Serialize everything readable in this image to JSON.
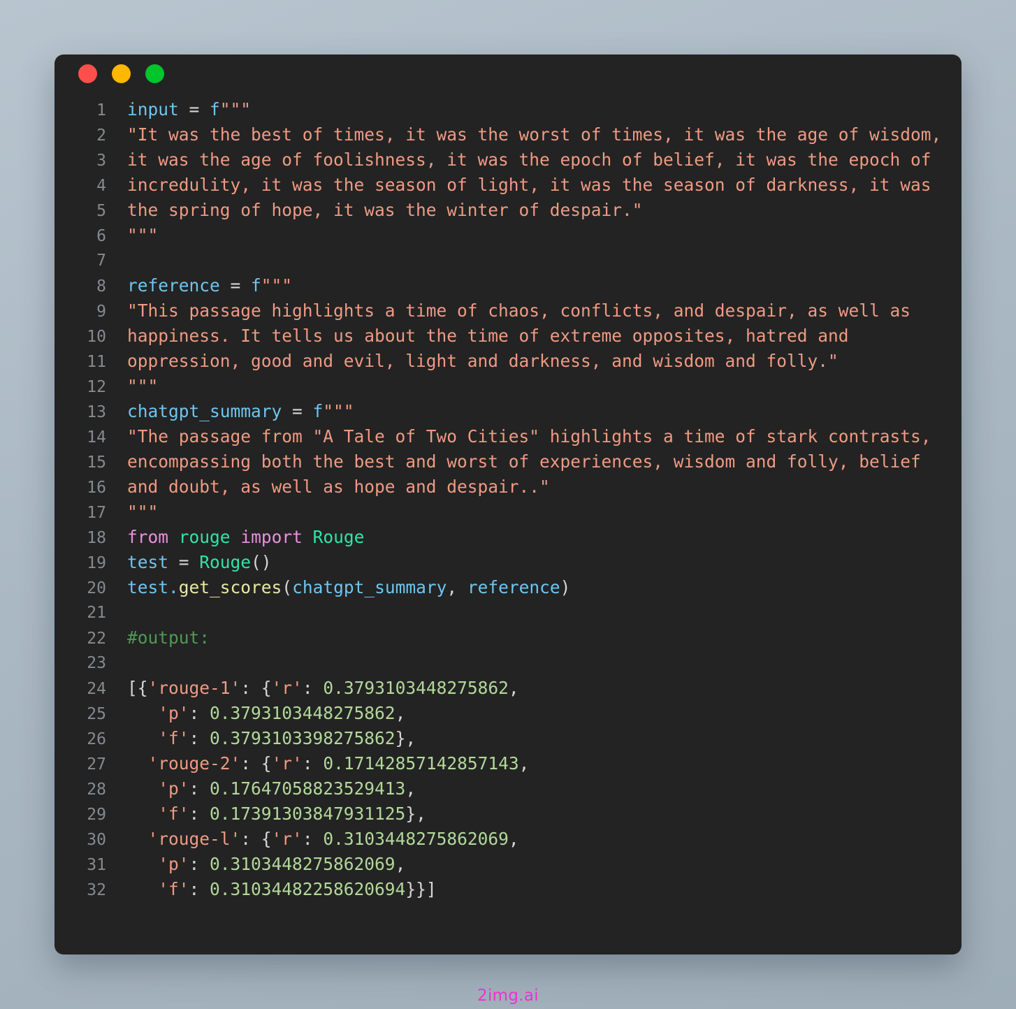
{
  "window": {
    "title_bar": {
      "close_label": "close",
      "minimize_label": "minimize",
      "maximize_label": "maximize"
    },
    "colors": {
      "background_panel": "#232323",
      "close_dot": "#ff4f4b",
      "minimize_dot": "#ffb700",
      "maximize_dot": "#00c62b",
      "line_number": "#848b90",
      "variable": "#6ec5ef",
      "string": "#ef9a83",
      "keyword": "#e98fe0",
      "class": "#2de6a8",
      "function": "#e8e8a3",
      "number": "#b2d89a",
      "comment": "#4e9a53",
      "watermark": "#f42ad3"
    }
  },
  "watermark": "2img.ai",
  "code": {
    "language": "python",
    "line_numbers": [
      1,
      2,
      3,
      4,
      5,
      6,
      7,
      8,
      9,
      10,
      11,
      12,
      13,
      14,
      15,
      16,
      17,
      18,
      19,
      20,
      21,
      22,
      23,
      24,
      25,
      26,
      27,
      28,
      29,
      30,
      31,
      32
    ],
    "lines": [
      {
        "n": "1",
        "text": "input = f\"\"\""
      },
      {
        "n": "2",
        "text": "\"It was the best of times, it was the worst of times, it was the age of wisdom,"
      },
      {
        "n": "3",
        "text": "it was the age of foolishness, it was the epoch of belief, it was the epoch of"
      },
      {
        "n": "4",
        "text": "incredulity, it was the season of light, it was the season of darkness, it was"
      },
      {
        "n": "5",
        "text": "the spring of hope, it was the winter of despair.\""
      },
      {
        "n": "6",
        "text": "\"\"\""
      },
      {
        "n": "7",
        "text": ""
      },
      {
        "n": "8",
        "text": "reference = f\"\"\""
      },
      {
        "n": "9",
        "text": "\"This passage highlights a time of chaos, conflicts, and despair, as well as"
      },
      {
        "n": "10",
        "text": "happiness. It tells us about the time of extreme opposites, hatred and"
      },
      {
        "n": "11",
        "text": "oppression, good and evil, light and darkness, and wisdom and folly.\""
      },
      {
        "n": "12",
        "text": "\"\"\""
      },
      {
        "n": "13",
        "text": "chatgpt_summary = f\"\"\""
      },
      {
        "n": "14",
        "text": "\"The passage from \"A Tale of Two Cities\" highlights a time of stark contrasts,"
      },
      {
        "n": "15",
        "text": "encompassing both the best and worst of experiences, wisdom and folly, belief"
      },
      {
        "n": "16",
        "text": "and doubt, as well as hope and despair..\""
      },
      {
        "n": "17",
        "text": "\"\"\""
      },
      {
        "n": "18",
        "text": "from rouge import Rouge"
      },
      {
        "n": "19",
        "text": "test = Rouge()"
      },
      {
        "n": "20",
        "text": "test.get_scores(chatgpt_summary, reference)"
      },
      {
        "n": "21",
        "text": ""
      },
      {
        "n": "22",
        "text": "#output:"
      },
      {
        "n": "23",
        "text": ""
      },
      {
        "n": "24",
        "text": "[{'rouge-1': {'r': 0.3793103448275862,"
      },
      {
        "n": "25",
        "text": "   'p': 0.3793103448275862,"
      },
      {
        "n": "26",
        "text": "   'f': 0.3793103398275862},"
      },
      {
        "n": "27",
        "text": "  'rouge-2': {'r': 0.17142857142857143,"
      },
      {
        "n": "28",
        "text": "   'p': 0.17647058823529413,"
      },
      {
        "n": "29",
        "text": "   'f': 0.17391303847931125},"
      },
      {
        "n": "30",
        "text": "  'rouge-l': {'r': 0.3103448275862069,"
      },
      {
        "n": "31",
        "text": "   'p': 0.3103448275862069,"
      },
      {
        "n": "32",
        "text": "   'f': 0.31034482258620694}}]"
      }
    ],
    "variables": {
      "input_name": "input",
      "reference_name": "reference",
      "summary_name": "chatgpt_summary",
      "test_name": "test"
    },
    "import_statement": {
      "keyword_from": "from",
      "module": "rouge",
      "keyword_import": "import",
      "class_name": "Rouge"
    },
    "method_call": {
      "object": "test",
      "method": "get_scores",
      "arg1": "chatgpt_summary",
      "arg2": "reference"
    },
    "comment": "#output:",
    "results": {
      "rouge-1": {
        "r": "0.3793103448275862",
        "p": "0.3793103448275862",
        "f": "0.3793103398275862"
      },
      "rouge-2": {
        "r": "0.17142857142857143",
        "p": "0.17647058823529413",
        "f": "0.17391303847931125"
      },
      "rouge-l": {
        "r": "0.3103448275862069",
        "p": "0.3103448275862069",
        "f": "0.31034482258620694"
      }
    }
  }
}
